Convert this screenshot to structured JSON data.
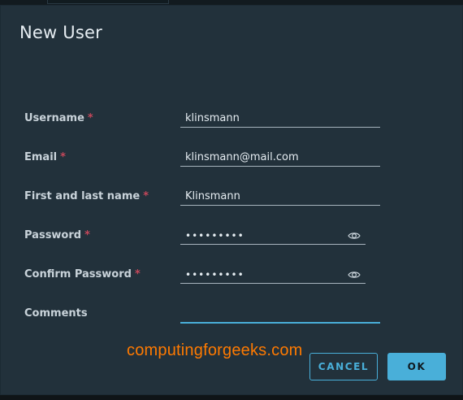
{
  "dialog": {
    "title": "New User",
    "fields": [
      {
        "label": "Username",
        "required_marker": "*",
        "value": "klinsmann"
      },
      {
        "label": "Email",
        "required_marker": "*",
        "value": "klinsmann@mail.com"
      },
      {
        "label": "First and last name",
        "required_marker": "*",
        "value": "Klinsmann"
      },
      {
        "label": "Password",
        "required_marker": "*",
        "value": "•••••••••",
        "icon": "eye-icon"
      },
      {
        "label": "Confirm Password",
        "required_marker": "*",
        "value": "•••••••••",
        "icon": "eye-icon"
      },
      {
        "label": "Comments",
        "value": ""
      }
    ],
    "buttons": {
      "cancel": "CANCEL",
      "ok": "OK"
    }
  },
  "watermark": "computingforgeeks.com",
  "colors": {
    "dialog_bg": "#22313b",
    "accent": "#49afd9",
    "required": "#c4475a",
    "watermark": "#ff7a00"
  }
}
